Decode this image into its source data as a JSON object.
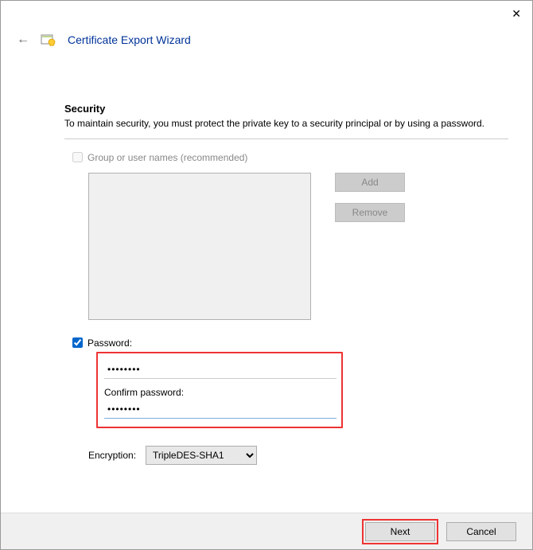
{
  "window": {
    "title": "Certificate Export Wizard"
  },
  "section": {
    "heading": "Security",
    "description": "To maintain security, you must protect the private key to a security principal or by using a password."
  },
  "group_names": {
    "checkbox_label": "Group or user names (recommended)",
    "add_button": "Add",
    "remove_button": "Remove"
  },
  "password": {
    "checkbox_label": "Password:",
    "value": "••••••••",
    "confirm_label": "Confirm password:",
    "confirm_value": "••••••••"
  },
  "encryption": {
    "label": "Encryption:",
    "selected": "TripleDES-SHA1"
  },
  "footer": {
    "next": "Next",
    "cancel": "Cancel"
  }
}
